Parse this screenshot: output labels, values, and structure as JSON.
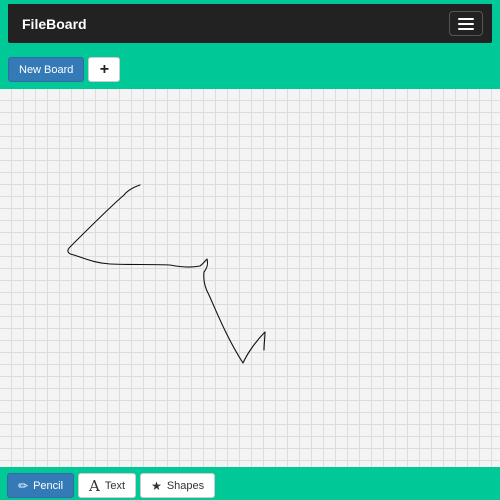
{
  "app": {
    "title": "FileBoard"
  },
  "navbar": {
    "menu_icon": "hamburger-menu-icon"
  },
  "toolbar": {
    "new_board_label": "New Board",
    "add_icon": "plus-icon",
    "add_glyph": "+"
  },
  "canvas": {
    "grid": true,
    "stroke_color": "#111111"
  },
  "tools": [
    {
      "label": "Pencil",
      "icon": "pencil-icon",
      "glyph": "✏",
      "active": true
    },
    {
      "label": "Text",
      "icon": "text-icon",
      "glyph": "A",
      "active": false
    },
    {
      "label": "Shapes",
      "icon": "star-icon",
      "glyph": "★",
      "active": false
    }
  ],
  "colors": {
    "accent": "#00c896",
    "navbar": "#222222",
    "primary": "#337ab7"
  }
}
